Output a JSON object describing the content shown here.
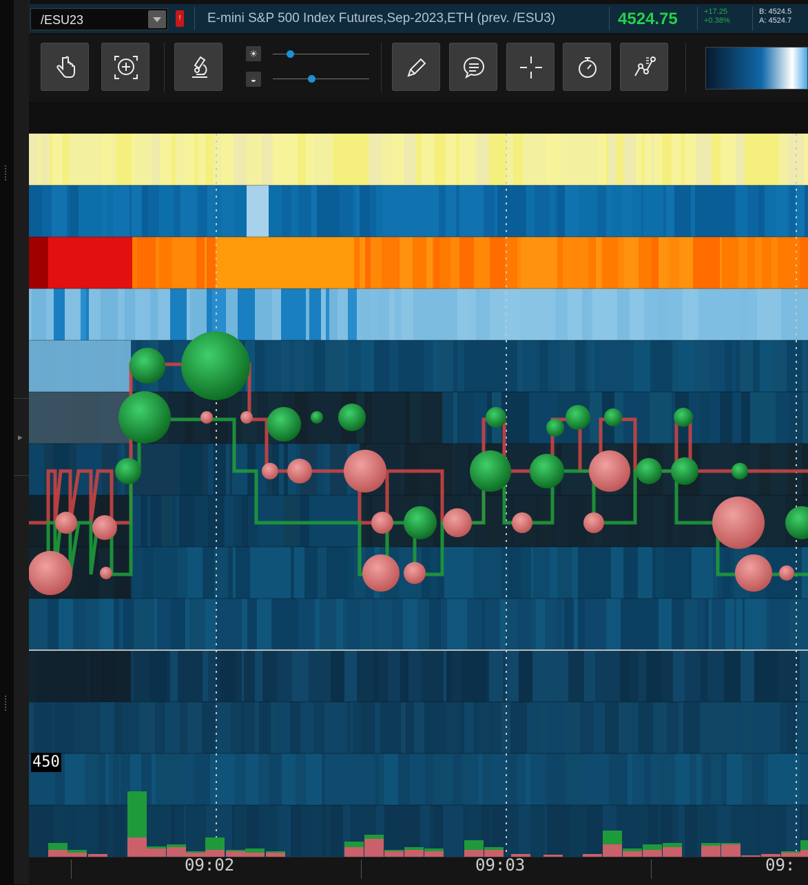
{
  "header": {
    "symbol": "/ESU23",
    "alert_badge": "!",
    "description": "E-mini S&P 500 Index Futures,Sep-2023,ETH (prev. /ESU3)",
    "last_price": "4524.75",
    "change_abs": "+17.25",
    "change_pct": "+0.38%",
    "bid": "B: 4524.5",
    "ask": "A: 4524.7"
  },
  "toolbar": {
    "buttons": [
      {
        "name": "hand-tool",
        "icon": "hand-pointer-icon"
      },
      {
        "name": "zoom-tool",
        "icon": "zoom-target-icon"
      },
      {
        "name": "microscope-tool",
        "icon": "microscope-icon"
      },
      {
        "name": "drawing-tool",
        "icon": "pencil-icon"
      },
      {
        "name": "comment-tool",
        "icon": "speech-bubble-icon"
      },
      {
        "name": "crosshair-tool",
        "icon": "crosshair-icon"
      },
      {
        "name": "timer-tool",
        "icon": "stopwatch-icon"
      },
      {
        "name": "trend-tool",
        "icon": "line-chart-icon"
      }
    ],
    "brightness_slider": {
      "icon": "brightness-icon",
      "value_fraction": 0.18
    },
    "contrast_slider": {
      "icon": "contrast-icon",
      "value_fraction": 0.4
    },
    "colors": {
      "accent": "#1e90d6",
      "buy": "#1f9a3a",
      "sell": "#d24a4a",
      "price_up": "#23d14b"
    }
  },
  "chart": {
    "price_level_label": "450"
  },
  "time_axis": {
    "labels": [
      "09:02",
      "09:03",
      "09:"
    ]
  }
}
